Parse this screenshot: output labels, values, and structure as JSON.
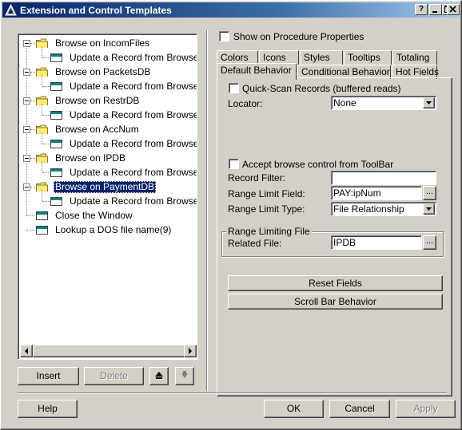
{
  "window": {
    "title": "Extension and Control Templates"
  },
  "title_buttons": {
    "help": "?",
    "minimize": "_",
    "maximize": "□",
    "close": "✕"
  },
  "tree": {
    "items": [
      {
        "label": "Browse on IncomFiles",
        "type": "folder"
      },
      {
        "label": "Update a Record from Browse Box",
        "type": "window"
      },
      {
        "label": "Browse on PacketsDB",
        "type": "folder"
      },
      {
        "label": "Update a Record from Browse Box",
        "type": "window"
      },
      {
        "label": "Browse on RestrDB",
        "type": "folder"
      },
      {
        "label": "Update a Record from Browse Box",
        "type": "window"
      },
      {
        "label": "Browse on AccNum",
        "type": "folder"
      },
      {
        "label": "Update a Record from Browse Box",
        "type": "window"
      },
      {
        "label": "Browse on IPDB",
        "type": "folder"
      },
      {
        "label": "Update a Record from Browse Box",
        "type": "window"
      },
      {
        "label": "Browse on PaymentDB",
        "type": "folder",
        "selected": true
      },
      {
        "label": "Update a Record from Browse Box",
        "type": "window"
      },
      {
        "label": "Close the Window",
        "type": "window"
      },
      {
        "label": "Lookup a DOS file name(9)",
        "type": "window"
      }
    ]
  },
  "tree_buttons": {
    "insert": "Insert",
    "delete": "Delete",
    "up": "▲",
    "down": "▼"
  },
  "options": {
    "show_on_procedure_properties": "Show on Procedure Properties"
  },
  "tabs": {
    "row1": [
      "Colors",
      "Icons",
      "Styles",
      "Tooltips",
      "Totaling"
    ],
    "row2": [
      "Default Behavior",
      "Conditional Behavior",
      "Hot Fields"
    ],
    "active": "Default Behavior"
  },
  "form": {
    "quick_scan_label": "Quick-Scan Records (buffered reads)",
    "locator_label": "Locator:",
    "locator_value": "None",
    "accept_browse_label": "Accept browse control from ToolBar",
    "record_filter_label": "Record Filter:",
    "record_filter_value": "",
    "range_limit_field_label": "Range Limit Field:",
    "range_limit_field_value": "PAY:ipNum",
    "range_limit_type_label": "Range Limit Type:",
    "range_limit_type_value": "File Relationship",
    "range_group_title": "Range Limiting File",
    "related_file_label": "Related File:",
    "related_file_value": "IPDB",
    "ellipsis": "...",
    "reset_fields": "Reset Fields",
    "scroll_bar_behavior": "Scroll Bar Behavior"
  },
  "footer": {
    "help": "Help",
    "ok": "OK",
    "cancel": "Cancel",
    "apply": "Apply"
  },
  "colors": {
    "titlebar_start": "#0a246a",
    "titlebar_end": "#a6caf0",
    "selection": "#0a246a",
    "face": "#d4d0c8"
  }
}
